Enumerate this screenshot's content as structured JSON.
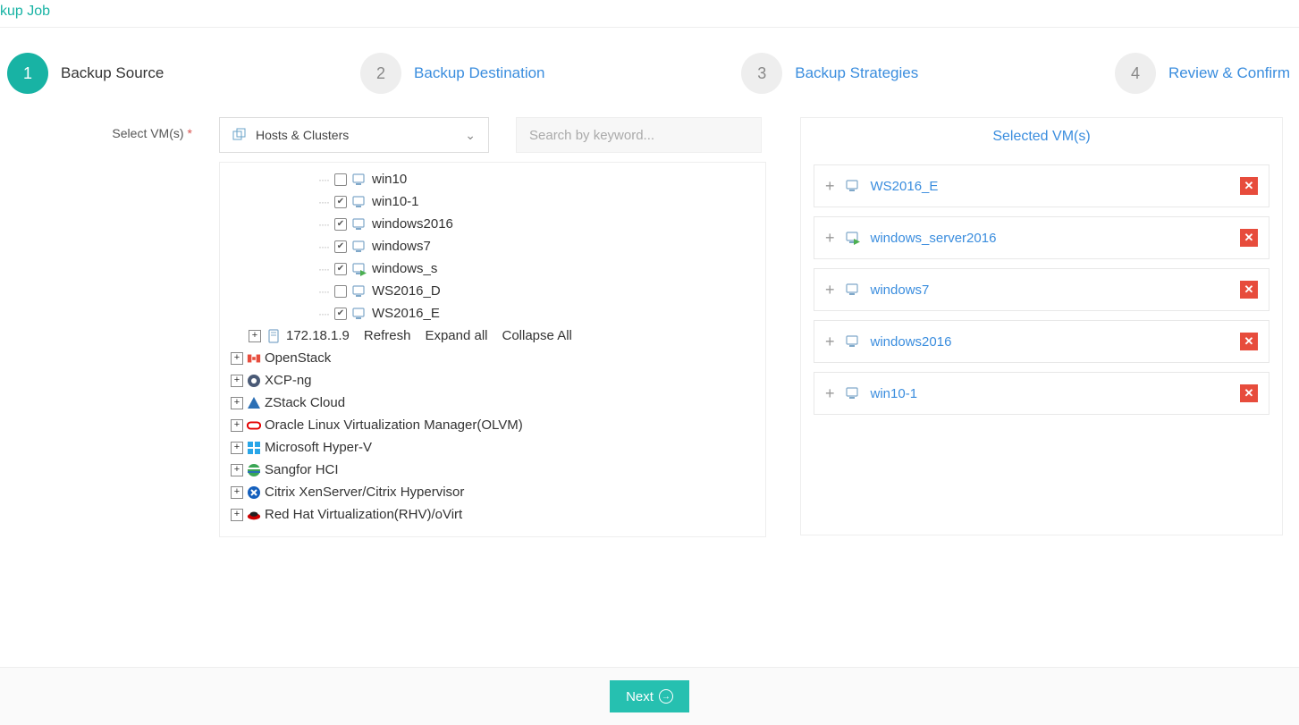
{
  "page": {
    "title_fragment": "kup Job"
  },
  "wizard": {
    "steps": [
      {
        "num": "1",
        "label": "Backup Source",
        "active": true
      },
      {
        "num": "2",
        "label": "Backup Destination",
        "active": false
      },
      {
        "num": "3",
        "label": "Backup Strategies",
        "active": false
      },
      {
        "num": "4",
        "label": "Review & Confirm",
        "active": false
      }
    ]
  },
  "form": {
    "select_vms_label": "Select VM(s)",
    "dropdown_label": "Hosts & Clusters",
    "search_placeholder": "Search by keyword..."
  },
  "tree": {
    "vms": [
      {
        "name": "win10",
        "checked": false,
        "running": false
      },
      {
        "name": "win10-1",
        "checked": true,
        "running": false
      },
      {
        "name": "windows2016",
        "checked": true,
        "running": false
      },
      {
        "name": "windows7",
        "checked": true,
        "running": false
      },
      {
        "name": "windows_s",
        "checked": true,
        "running": true
      },
      {
        "name": "WS2016_D",
        "checked": false,
        "running": false
      },
      {
        "name": "WS2016_E",
        "checked": true,
        "running": false
      }
    ],
    "host": {
      "ip": "172.18.1.9",
      "actions": {
        "refresh": "Refresh",
        "expand": "Expand all",
        "collapse": "Collapse All"
      }
    },
    "platforms": [
      {
        "name": "OpenStack",
        "icon": "openstack"
      },
      {
        "name": "XCP-ng",
        "icon": "xcpng"
      },
      {
        "name": "ZStack Cloud",
        "icon": "zstack"
      },
      {
        "name": "Oracle Linux Virtualization Manager(OLVM)",
        "icon": "oracle"
      },
      {
        "name": "Microsoft Hyper-V",
        "icon": "hyperv"
      },
      {
        "name": "Sangfor HCI",
        "icon": "sangfor"
      },
      {
        "name": "Citrix XenServer/Citrix Hypervisor",
        "icon": "citrix"
      },
      {
        "name": "Red Hat Virtualization(RHV)/oVirt",
        "icon": "redhat"
      }
    ]
  },
  "selected": {
    "title": "Selected VM(s)",
    "items": [
      {
        "name": "WS2016_E",
        "running": false
      },
      {
        "name": "windows_server2016",
        "running": true
      },
      {
        "name": "windows7",
        "running": false
      },
      {
        "name": "windows2016",
        "running": false
      },
      {
        "name": "win10-1",
        "running": false
      }
    ]
  },
  "footer": {
    "next": "Next"
  }
}
